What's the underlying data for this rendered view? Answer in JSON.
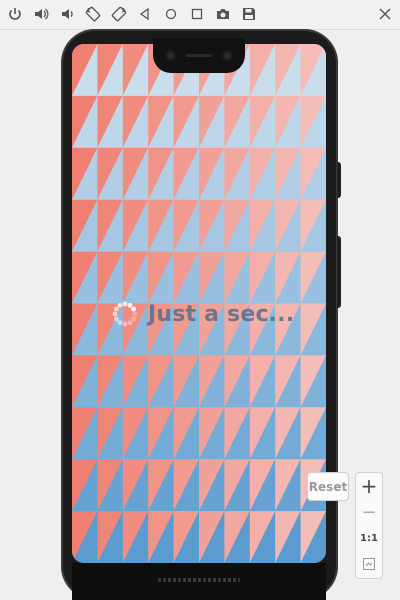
{
  "toolbar": {
    "icons": [
      "power-icon",
      "volume-up-icon",
      "volume-down-icon",
      "rotate-left-icon",
      "rotate-right-icon",
      "back-icon",
      "home-icon",
      "overview-icon",
      "camera-icon",
      "save-icon",
      "close-icon"
    ]
  },
  "screen": {
    "loading_text": "Just a sec...",
    "colors": {
      "pink": "#f4bdb8",
      "coral": "#ef7f70",
      "light_blue": "#c9ddec",
      "blue": "#5c9bd0"
    }
  },
  "zoom": {
    "reset_label": "Reset",
    "zoom_in_label": "+",
    "zoom_out_label": "−",
    "actual_size_label": "1:1"
  },
  "colors": {
    "toolbar_bg": "#f1f1f1",
    "device_bg": "#1b1b1b"
  }
}
